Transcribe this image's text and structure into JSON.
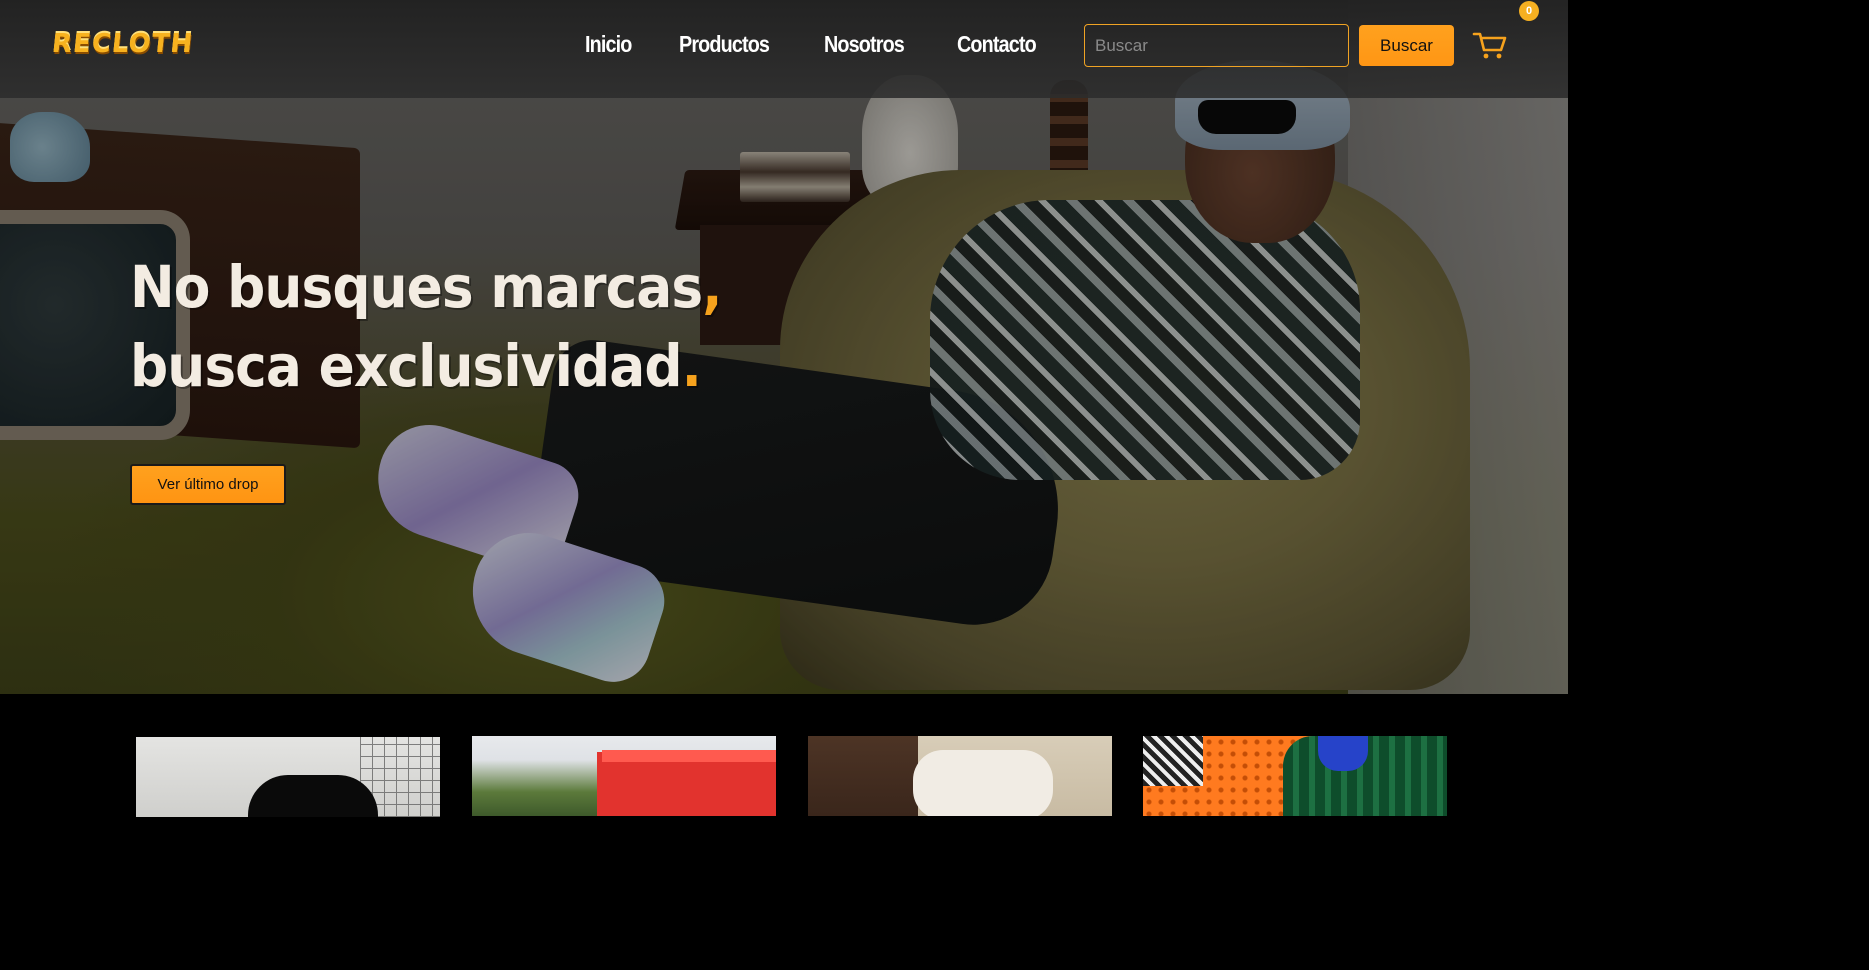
{
  "header": {
    "logo_text": "RECLOTH",
    "nav": [
      {
        "label": "Inicio"
      },
      {
        "label": "Productos"
      },
      {
        "label": "Nosotros"
      },
      {
        "label": "Contacto"
      }
    ],
    "search": {
      "placeholder": "Buscar",
      "value": "",
      "button_label": "Buscar"
    },
    "cart": {
      "icon": "shopping-cart-icon",
      "count": "0"
    }
  },
  "hero": {
    "title_line1": "No busques marcas",
    "title_line1_accent": ",",
    "title_line2": "busca exclusividad",
    "title_line2_accent": ".",
    "cta_label": "Ver último drop"
  },
  "colors": {
    "accent": "#ff9a18",
    "navbar_bg": "#262626",
    "page_bg": "#000000",
    "hero_text": "#f3ece2"
  },
  "products": {
    "cards": [
      {
        "image": "black-hoodie-photo"
      },
      {
        "image": "red-booth-outdoor-photo"
      },
      {
        "image": "bed-pillows-photo"
      },
      {
        "image": "green-plaid-jacket-orange-wall-photo"
      }
    ]
  }
}
